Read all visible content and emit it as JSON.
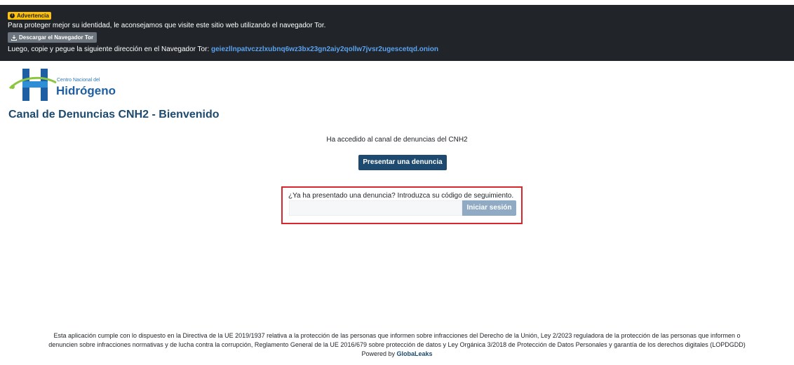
{
  "tor_banner": {
    "badge_label": "Advertencia",
    "message": "Para proteger mejor su identidad, le aconsejamos que visite este sitio web utilizando el navegador Tor.",
    "download_label": "Descargar el Navegador Tor",
    "copy_instruction": "Luego, copie y pegue la siguiente dirección en el Navegador Tor:",
    "onion_address": "geiezllnpatvczzlxubnq6wz3bx23gn2aiy2qollw7jvsr2ugescetqd.onion"
  },
  "logo": {
    "org_small": "Centro Nacional del",
    "org_big": "Hidrógeno"
  },
  "page": {
    "title": "Canal de Denuncias CNH2 - Bienvenido",
    "welcome": "Ha accedido al canal de denuncias del CNH2",
    "submit_label": "Presentar una denuncia"
  },
  "login": {
    "prompt": "¿Ya ha presentado una denuncia? Introduzca su código de seguimiento.",
    "input_value": "",
    "button_label": "Iniciar sesión"
  },
  "footer": {
    "legal_line1": "Esta aplicación cumple con lo dispuesto en la Directiva de la UE 2019/1937 relativa a la protección de las personas que informen sobre infracciones del Derecho de la Unión, Ley 2/2023 reguladora de la protección de las personas que informen o",
    "legal_line2": "denuncien sobre infracciones normativas y de lucha contra la corrupción, Reglamento General de la UE 2016/679 sobre protección de datos y Ley Orgánica 3/2018 de Protección de Datos Personales y garantía de los derechos digitales (LOPDGDD)",
    "powered_prefix": "Powered by",
    "powered_brand": "GlobaLeaks"
  },
  "colors": {
    "banner_bg": "#212529",
    "warning": "#ffc107",
    "primary": "#1d4a6e",
    "highlight_border": "#d9262c",
    "onion_link": "#5aa3f0"
  },
  "icons": {
    "badge": "exclamation-circle-icon",
    "download": "download-icon"
  }
}
